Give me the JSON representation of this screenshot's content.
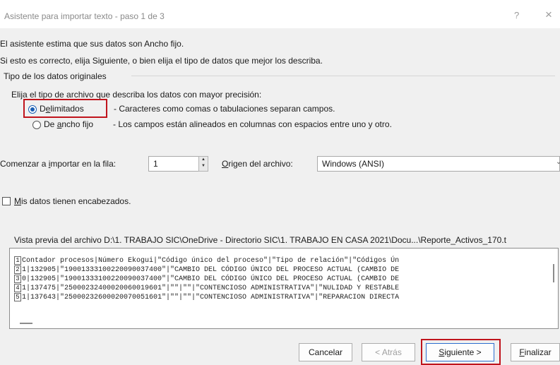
{
  "window": {
    "title": "Asistente para importar texto - paso 1 de 3",
    "help_icon": "?",
    "close_icon": "×"
  },
  "intro": {
    "line1": "El asistente estima que sus datos son Ancho fijo.",
    "line2": "Si esto es correcto, elija Siguiente, o bien elija el tipo de datos que mejor los describa."
  },
  "data_type_group": {
    "legend": "Tipo de los datos originales",
    "instruction": "Elija el tipo de archivo que describa los datos con mayor precisión:",
    "options": [
      {
        "label_pre": "D",
        "label_key": "e",
        "label_post": "limitados",
        "description": "- Caracteres como comas o tabulaciones separan campos.",
        "selected": true
      },
      {
        "label_pre": "De ",
        "label_key": "a",
        "label_post": "ncho fijo",
        "description": "- Los campos están alineados en columnas con espacios entre uno y otro.",
        "selected": false
      }
    ]
  },
  "import_settings": {
    "start_row_pre": "Comenzar a ",
    "start_row_key": "i",
    "start_row_post": "mportar en la fila:",
    "start_row_value": "1",
    "origin_key": "O",
    "origin_post": "rigen del archivo:",
    "origin_value": "Windows (ANSI)"
  },
  "headers_checkbox": {
    "label_key": "M",
    "label_post": "is datos tienen encabezados.",
    "checked": false
  },
  "preview": {
    "label": "Vista previa del archivo D:\\1. TRABAJO SIC\\OneDrive - Directorio SIC\\1. TRABAJO EN CASA 2021\\Docu...\\Reporte_Activos_170.t",
    "rows": [
      {
        "n": "1",
        "text": "Contador procesos|Número Ekogui|\"Código único del proceso\"|\"Tipo de relación\"|\"Códigos Ún"
      },
      {
        "n": "2",
        "text": "1|132905|\"19001333100220090037400\"|\"CAMBIO DEL CÓDIGO ÚNICO DEL PROCESO ACTUAL (CAMBIO DE"
      },
      {
        "n": "3",
        "text": "0|132905|\"19001333100220090037400\"|\"CAMBIO DEL CÓDIGO ÚNICO DEL PROCESO ACTUAL (CAMBIO DE"
      },
      {
        "n": "4",
        "text": "1|137475|\"25000232400020060019601\"|\"\"|\"\"|\"CONTENCIOSO ADMINISTRATIVA\"|\"NULIDAD Y RESTABLE"
      },
      {
        "n": "5",
        "text": "1|137643|\"25000232600020070051601\"|\"\"|\"\"|\"CONTENCIOSO ADMINISTRATIVA\"|\"REPARACION DIRECTA"
      }
    ]
  },
  "buttons": {
    "cancel": "Cancelar",
    "back": "< Atrás",
    "next_key": "S",
    "next_post": "iguiente >",
    "finish_key": "F",
    "finish_post": "inalizar"
  },
  "colors": {
    "highlight_box": "#c0141c",
    "radio_selected": "#1a5fb4"
  }
}
